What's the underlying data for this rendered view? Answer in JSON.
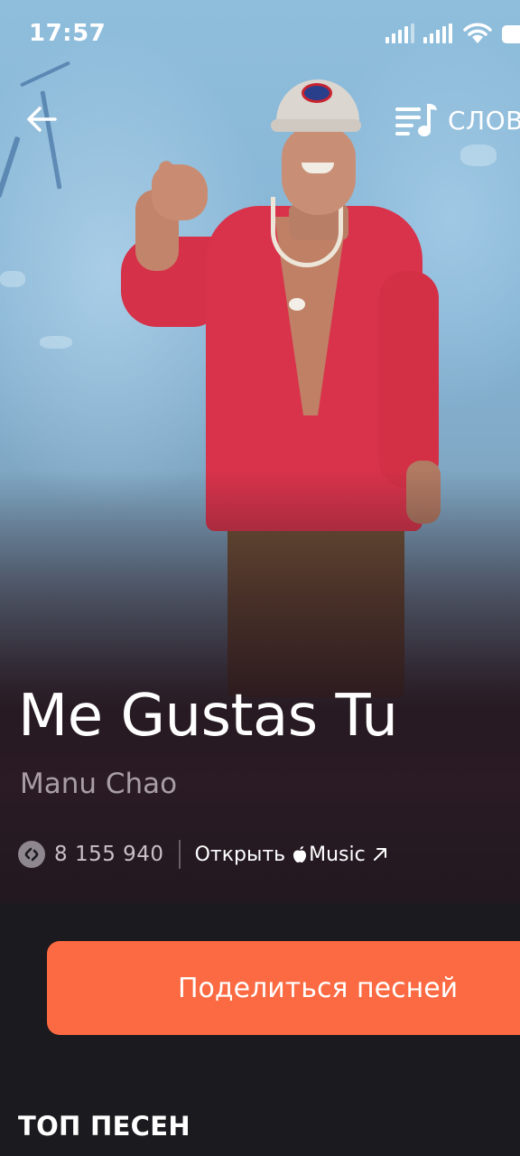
{
  "status_bar": {
    "time": "17:57",
    "icons": [
      "signal-icon",
      "signal-icon",
      "wifi-icon",
      "battery-icon"
    ]
  },
  "top_bar": {
    "back_icon": "arrow-left-icon",
    "lyrics_icon": "lyrics-icon",
    "lyrics_label": "СЛОВ"
  },
  "track": {
    "title": "Me Gustas Tu",
    "artist": "Manu Chao",
    "shazam_count": "8 155 940",
    "open_label": "Открыть",
    "apple_music_label": "Music"
  },
  "actions": {
    "share_label": "Поделиться песней"
  },
  "sections": {
    "top_songs": "ТОП ПЕСЕН"
  },
  "colors": {
    "accent": "#fb6a42",
    "background": "#1b1a1e",
    "secondary_text": "#a99ea5"
  }
}
